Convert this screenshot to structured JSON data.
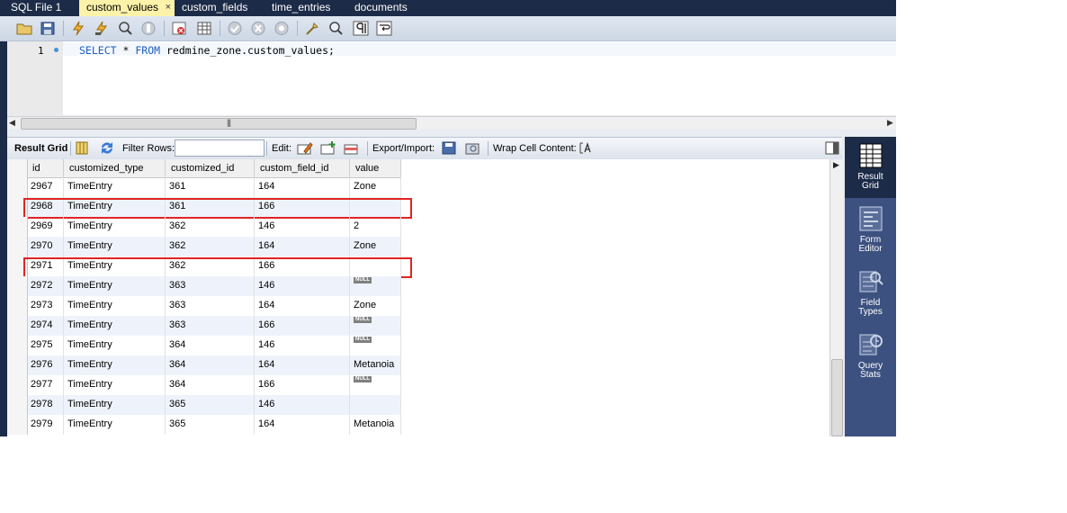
{
  "tabs": [
    {
      "label": "SQL File 1",
      "active": false
    },
    {
      "label": "custom_values",
      "active": true
    },
    {
      "label": "custom_fields",
      "active": false
    },
    {
      "label": "time_entries",
      "active": false
    },
    {
      "label": "documents",
      "active": false
    }
  ],
  "tab_close_glyph": "×",
  "editor": {
    "line_number": "1",
    "kw_select": "SELECT",
    "star": "*",
    "kw_from": "FROM",
    "target": "redmine_zone.custom_values;"
  },
  "scroll_grip": "|||",
  "result_toolbar": {
    "result_grid": "Result Grid",
    "filter_rows": "Filter Rows:",
    "filter_value": "",
    "edit": "Edit:",
    "export_import": "Export/Import:",
    "wrap_cell": "Wrap Cell Content:"
  },
  "grid": {
    "columns": [
      "id",
      "customized_type",
      "customized_id",
      "custom_field_id",
      "value"
    ],
    "null_label": "NULL",
    "rows": [
      {
        "id": "2967",
        "customized_type": "TimeEntry",
        "customized_id": "361",
        "custom_field_id": "164",
        "value": "Zone",
        "is_null": false
      },
      {
        "id": "2968",
        "customized_type": "TimeEntry",
        "customized_id": "361",
        "custom_field_id": "166",
        "value": "",
        "is_null": false,
        "highlighted": true
      },
      {
        "id": "2969",
        "customized_type": "TimeEntry",
        "customized_id": "362",
        "custom_field_id": "146",
        "value": "2",
        "is_null": false
      },
      {
        "id": "2970",
        "customized_type": "TimeEntry",
        "customized_id": "362",
        "custom_field_id": "164",
        "value": "Zone",
        "is_null": false
      },
      {
        "id": "2971",
        "customized_type": "TimeEntry",
        "customized_id": "362",
        "custom_field_id": "166",
        "value": "",
        "is_null": false,
        "highlighted": true
      },
      {
        "id": "2972",
        "customized_type": "TimeEntry",
        "customized_id": "363",
        "custom_field_id": "146",
        "value": "",
        "is_null": true
      },
      {
        "id": "2973",
        "customized_type": "TimeEntry",
        "customized_id": "363",
        "custom_field_id": "164",
        "value": "Zone",
        "is_null": false
      },
      {
        "id": "2974",
        "customized_type": "TimeEntry",
        "customized_id": "363",
        "custom_field_id": "166",
        "value": "",
        "is_null": true
      },
      {
        "id": "2975",
        "customized_type": "TimeEntry",
        "customized_id": "364",
        "custom_field_id": "146",
        "value": "",
        "is_null": true
      },
      {
        "id": "2976",
        "customized_type": "TimeEntry",
        "customized_id": "364",
        "custom_field_id": "164",
        "value": "Metanoia",
        "is_null": false
      },
      {
        "id": "2977",
        "customized_type": "TimeEntry",
        "customized_id": "364",
        "custom_field_id": "166",
        "value": "",
        "is_null": true
      },
      {
        "id": "2978",
        "customized_type": "TimeEntry",
        "customized_id": "365",
        "custom_field_id": "146",
        "value": "",
        "is_null": false
      },
      {
        "id": "2979",
        "customized_type": "TimeEntry",
        "customized_id": "365",
        "custom_field_id": "164",
        "value": "Metanoia",
        "is_null": false
      }
    ]
  },
  "sidebar": [
    {
      "label_line1": "Result",
      "label_line2": "Grid",
      "icon": "result-grid-icon",
      "active": true
    },
    {
      "label_line1": "Form",
      "label_line2": "Editor",
      "icon": "form-editor-icon",
      "active": false
    },
    {
      "label_line1": "Field",
      "label_line2": "Types",
      "icon": "field-types-icon",
      "active": false
    },
    {
      "label_line1": "Query",
      "label_line2": "Stats",
      "icon": "query-stats-icon",
      "active": false
    }
  ],
  "colors": {
    "tab_bar": "#1c2b47",
    "active_tab": "#fdf2a9",
    "sql_keyword": "#1f5fbf",
    "highlight_box": "#e02424",
    "sidebar": "#3d5180"
  }
}
